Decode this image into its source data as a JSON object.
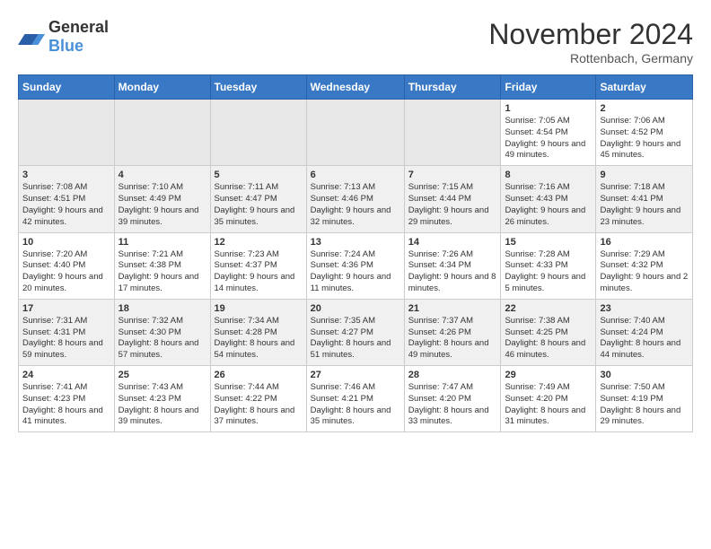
{
  "header": {
    "logo_general": "General",
    "logo_blue": "Blue",
    "month_year": "November 2024",
    "location": "Rottenbach, Germany"
  },
  "weekdays": [
    "Sunday",
    "Monday",
    "Tuesday",
    "Wednesday",
    "Thursday",
    "Friday",
    "Saturday"
  ],
  "weeks": [
    [
      {
        "day": "",
        "info": ""
      },
      {
        "day": "",
        "info": ""
      },
      {
        "day": "",
        "info": ""
      },
      {
        "day": "",
        "info": ""
      },
      {
        "day": "",
        "info": ""
      },
      {
        "day": "1",
        "info": "Sunrise: 7:05 AM\nSunset: 4:54 PM\nDaylight: 9 hours and 49 minutes."
      },
      {
        "day": "2",
        "info": "Sunrise: 7:06 AM\nSunset: 4:52 PM\nDaylight: 9 hours and 45 minutes."
      }
    ],
    [
      {
        "day": "3",
        "info": "Sunrise: 7:08 AM\nSunset: 4:51 PM\nDaylight: 9 hours and 42 minutes."
      },
      {
        "day": "4",
        "info": "Sunrise: 7:10 AM\nSunset: 4:49 PM\nDaylight: 9 hours and 39 minutes."
      },
      {
        "day": "5",
        "info": "Sunrise: 7:11 AM\nSunset: 4:47 PM\nDaylight: 9 hours and 35 minutes."
      },
      {
        "day": "6",
        "info": "Sunrise: 7:13 AM\nSunset: 4:46 PM\nDaylight: 9 hours and 32 minutes."
      },
      {
        "day": "7",
        "info": "Sunrise: 7:15 AM\nSunset: 4:44 PM\nDaylight: 9 hours and 29 minutes."
      },
      {
        "day": "8",
        "info": "Sunrise: 7:16 AM\nSunset: 4:43 PM\nDaylight: 9 hours and 26 minutes."
      },
      {
        "day": "9",
        "info": "Sunrise: 7:18 AM\nSunset: 4:41 PM\nDaylight: 9 hours and 23 minutes."
      }
    ],
    [
      {
        "day": "10",
        "info": "Sunrise: 7:20 AM\nSunset: 4:40 PM\nDaylight: 9 hours and 20 minutes."
      },
      {
        "day": "11",
        "info": "Sunrise: 7:21 AM\nSunset: 4:38 PM\nDaylight: 9 hours and 17 minutes."
      },
      {
        "day": "12",
        "info": "Sunrise: 7:23 AM\nSunset: 4:37 PM\nDaylight: 9 hours and 14 minutes."
      },
      {
        "day": "13",
        "info": "Sunrise: 7:24 AM\nSunset: 4:36 PM\nDaylight: 9 hours and 11 minutes."
      },
      {
        "day": "14",
        "info": "Sunrise: 7:26 AM\nSunset: 4:34 PM\nDaylight: 9 hours and 8 minutes."
      },
      {
        "day": "15",
        "info": "Sunrise: 7:28 AM\nSunset: 4:33 PM\nDaylight: 9 hours and 5 minutes."
      },
      {
        "day": "16",
        "info": "Sunrise: 7:29 AM\nSunset: 4:32 PM\nDaylight: 9 hours and 2 minutes."
      }
    ],
    [
      {
        "day": "17",
        "info": "Sunrise: 7:31 AM\nSunset: 4:31 PM\nDaylight: 8 hours and 59 minutes."
      },
      {
        "day": "18",
        "info": "Sunrise: 7:32 AM\nSunset: 4:30 PM\nDaylight: 8 hours and 57 minutes."
      },
      {
        "day": "19",
        "info": "Sunrise: 7:34 AM\nSunset: 4:28 PM\nDaylight: 8 hours and 54 minutes."
      },
      {
        "day": "20",
        "info": "Sunrise: 7:35 AM\nSunset: 4:27 PM\nDaylight: 8 hours and 51 minutes."
      },
      {
        "day": "21",
        "info": "Sunrise: 7:37 AM\nSunset: 4:26 PM\nDaylight: 8 hours and 49 minutes."
      },
      {
        "day": "22",
        "info": "Sunrise: 7:38 AM\nSunset: 4:25 PM\nDaylight: 8 hours and 46 minutes."
      },
      {
        "day": "23",
        "info": "Sunrise: 7:40 AM\nSunset: 4:24 PM\nDaylight: 8 hours and 44 minutes."
      }
    ],
    [
      {
        "day": "24",
        "info": "Sunrise: 7:41 AM\nSunset: 4:23 PM\nDaylight: 8 hours and 41 minutes."
      },
      {
        "day": "25",
        "info": "Sunrise: 7:43 AM\nSunset: 4:23 PM\nDaylight: 8 hours and 39 minutes."
      },
      {
        "day": "26",
        "info": "Sunrise: 7:44 AM\nSunset: 4:22 PM\nDaylight: 8 hours and 37 minutes."
      },
      {
        "day": "27",
        "info": "Sunrise: 7:46 AM\nSunset: 4:21 PM\nDaylight: 8 hours and 35 minutes."
      },
      {
        "day": "28",
        "info": "Sunrise: 7:47 AM\nSunset: 4:20 PM\nDaylight: 8 hours and 33 minutes."
      },
      {
        "day": "29",
        "info": "Sunrise: 7:49 AM\nSunset: 4:20 PM\nDaylight: 8 hours and 31 minutes."
      },
      {
        "day": "30",
        "info": "Sunrise: 7:50 AM\nSunset: 4:19 PM\nDaylight: 8 hours and 29 minutes."
      }
    ]
  ]
}
